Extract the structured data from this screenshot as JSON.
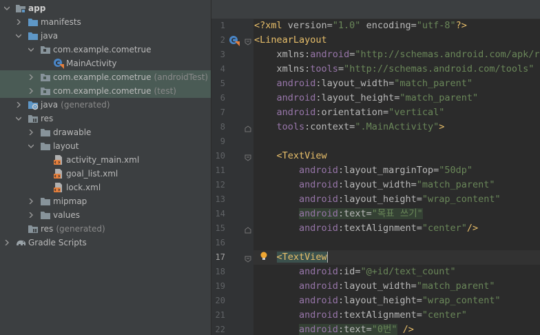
{
  "project_tree": {
    "app": "app",
    "manifests": "manifests",
    "java": "java",
    "pkg_main": "com.example.cometrue",
    "main_activity": "MainActivity",
    "pkg_android_test": "com.example.cometrue",
    "pkg_android_test_suffix": "(androidTest)",
    "pkg_test": "com.example.cometrue",
    "pkg_test_suffix": "(test)",
    "java_generated": "java",
    "java_generated_suffix": "(generated)",
    "res": "res",
    "drawable": "drawable",
    "layout": "layout",
    "file_activity_main": "activity_main.xml",
    "file_goal_list": "goal_list.xml",
    "file_lock": "lock.xml",
    "mipmap": "mipmap",
    "values": "values",
    "res_generated": "res",
    "res_generated_suffix": "(generated)",
    "gradle_scripts": "Gradle Scripts"
  },
  "editor": {
    "line_numbers": [
      "1",
      "2",
      "3",
      "4",
      "5",
      "6",
      "7",
      "8",
      "9",
      "10",
      "11",
      "12",
      "13",
      "14",
      "15",
      "16",
      "17",
      "18",
      "19",
      "20",
      "21",
      "22"
    ],
    "current_line": "17",
    "code": {
      "l1": {
        "pi_open": "<?xml",
        "a1": " version=",
        "v1": "\"1.0\"",
        "a2": " encoding=",
        "v2": "\"utf-8\"",
        "pi_close": "?>"
      },
      "l2": {
        "tag": "<LinearLayout"
      },
      "l3": {
        "ns": "xmlns",
        "sep": ":",
        "attr": "android",
        "eq": "=",
        "val": "\"http://schemas.android.com/apk/res/android\""
      },
      "l4": {
        "ns": "xmlns",
        "sep": ":",
        "attr": "tools",
        "eq": "=",
        "val": "\"http://schemas.android.com/tools\""
      },
      "l5": {
        "ns": "android",
        "attr": ":layout_width=",
        "val": "\"match_parent\""
      },
      "l6": {
        "ns": "android",
        "attr": ":layout_height=",
        "val": "\"match_parent\""
      },
      "l7": {
        "ns": "android",
        "attr": ":orientation=",
        "val": "\"vertical\""
      },
      "l8": {
        "ns": "tools",
        "attr": ":context=",
        "val": "\".MainActivity\"",
        "close": ">"
      },
      "l10": {
        "tag": "<TextView"
      },
      "l11": {
        "ns": "android",
        "attr": ":layout_marginTop=",
        "val": "\"50dp\""
      },
      "l12": {
        "ns": "android",
        "attr": ":layout_width=",
        "val": "\"match_parent\""
      },
      "l13": {
        "ns": "android",
        "attr": ":layout_height=",
        "val": "\"wrap_content\""
      },
      "l14": {
        "ns": "android",
        "attr": ":text=",
        "val": "\"목표 쓰기\""
      },
      "l15": {
        "ns": "android",
        "attr": ":textAlignment=",
        "val": "\"center\"",
        "close": "/>"
      },
      "l17": {
        "tag": "<TextView"
      },
      "l18": {
        "ns": "android",
        "attr": ":id=",
        "val": "\"@+id/text_count\""
      },
      "l19": {
        "ns": "android",
        "attr": ":layout_width=",
        "val": "\"match_parent\""
      },
      "l20": {
        "ns": "android",
        "attr": ":layout_height=",
        "val": "\"wrap_content\""
      },
      "l21": {
        "ns": "android",
        "attr": ":textAlignment=",
        "val": "\"center\""
      },
      "l22": {
        "ns": "android",
        "attr": ":text=",
        "val": "\"0번\"",
        "close": " />"
      }
    }
  },
  "colors": {
    "tree_bg": "#3c3f41",
    "selection": "#4a5b55",
    "editor_bg": "#2b2b2b",
    "gutter_bg": "#313335",
    "tag": "#e8bf6a",
    "namespace": "#9876aa",
    "value": "#6a8759",
    "folder_blue": "#5e97c7",
    "folder_grey": "#87939a"
  }
}
